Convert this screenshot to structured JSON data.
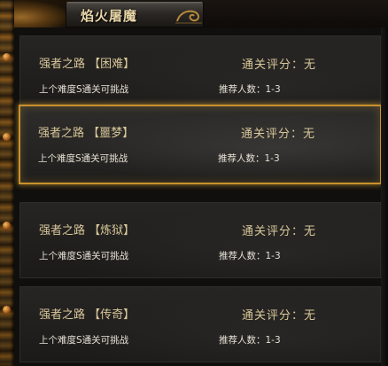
{
  "window": {
    "title": "焰火屠魔"
  },
  "dungeons": [
    {
      "name": "强者之路 【困难】",
      "score_label": "通关评分：",
      "score_value": "无",
      "requirement": "上个难度S通关可挑战",
      "players": "推荐人数：1-3"
    },
    {
      "name": "强者之路 【噩梦】",
      "score_label": "通关评分：",
      "score_value": "无",
      "requirement": "上个难度S通关可挑战",
      "players": "推荐人数：1-3"
    },
    {
      "name": "强者之路 【炼狱】",
      "score_label": "通关评分：",
      "score_value": "无",
      "requirement": "上个难度S通关可挑战",
      "players": "推荐人数：1-3"
    },
    {
      "name": "强者之路 【传奇】",
      "score_label": "通关评分：",
      "score_value": "无",
      "requirement": "上个难度S通关可挑战",
      "players": "推荐人数：1-3"
    }
  ],
  "colors": {
    "accent": "#c9922c",
    "title": "#e8d6a8",
    "label": "#d9c79a"
  }
}
